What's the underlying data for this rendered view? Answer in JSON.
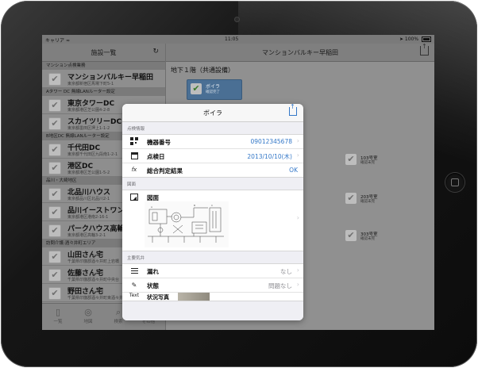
{
  "status_bar": {
    "carrier": "キャリア",
    "wifi": "≈",
    "time": "11:05",
    "location": "➤",
    "battery": "100%"
  },
  "master": {
    "title": "施設一覧",
    "refresh_icon": "refresh-icon",
    "sections": [
      {
        "header": "マンション点検業務",
        "rows": [
          {
            "name": "マンションバルキー早稲田",
            "address": "東京都新宿区馬場下町5-1"
          }
        ]
      },
      {
        "header": "Aタワー DC 無線LANルーター設定",
        "rows": [
          {
            "name": "東京タワーDC",
            "address": "東京都港区芝公園4-2-8"
          },
          {
            "name": "スカイツリーDC",
            "address": "東京都墨田区押上1-1-2"
          }
        ]
      },
      {
        "header": "B地区DC 無線LANルーター設定",
        "rows": [
          {
            "name": "千代田DC",
            "address": "東京都千代田区九段南1-2-1"
          },
          {
            "name": "港区DC",
            "address": "東京都港区芝公園1-5-2"
          }
        ]
      },
      {
        "header": "品川・大崎地区",
        "rows": [
          {
            "name": "北品川ハウス",
            "address": "東京都品川区北品川2-1"
          },
          {
            "name": "品川イーストワン",
            "address": "東京都港区港南2-16-1"
          },
          {
            "name": "パークハウス高輪",
            "address": "東京都港区高輪3-2-1"
          }
        ]
      },
      {
        "header": "訪問介護:酒々井町エリア",
        "rows": [
          {
            "name": "山田さん宅",
            "address": "千葉県印旛郡酒々井町上岩橋"
          },
          {
            "name": "佐藤さん宅",
            "address": "千葉県印旛郡酒々井町中央台"
          },
          {
            "name": "野田さん宅",
            "address": "千葉県印旛郡酒々井町東酒々井"
          }
        ]
      }
    ],
    "tabs": [
      {
        "label": "一覧",
        "icon": "list-icon"
      },
      {
        "label": "地図",
        "icon": "map-icon"
      },
      {
        "label": "検索",
        "icon": "search-icon"
      },
      {
        "label": "その他",
        "icon": "more-icon"
      }
    ]
  },
  "detail": {
    "title": "マンションバルキー早稲田",
    "share_icon": "share-icon",
    "floor": "地下１階（共通設備）",
    "boiler_chip": {
      "label": "ボイラ",
      "sub": "確認完了"
    },
    "rooms": [
      {
        "label": "103号室",
        "sub": "確認未完"
      },
      {
        "label": "203号室",
        "sub": "確認未完"
      },
      {
        "label": "303号室",
        "sub": "確認未完"
      }
    ]
  },
  "popover": {
    "title": "ボイラ",
    "share_icon": "share-icon",
    "inspection_section": "点検情報",
    "rows": {
      "equipment_no": {
        "label": "機器番号",
        "value": "09012345678",
        "icon": "qr-code-icon"
      },
      "inspection_date": {
        "label": "点検日",
        "value": "2013/10/10(木)",
        "icon": "calendar-icon"
      },
      "overall_result": {
        "label": "総合判定結果",
        "value": "OK",
        "icon": "fx-icon"
      }
    },
    "drawing_section": "図面",
    "drawing": {
      "label": "図面",
      "icon": "picture-icon"
    },
    "remarks_section": "主要気弁",
    "leak": {
      "label": "漏れ",
      "value": "なし",
      "icon": "list-icon"
    },
    "condition": {
      "label": "状態",
      "value": "問題なし",
      "icon": "pen-icon"
    },
    "text_tool": "Text",
    "photo_row": {
      "label": "状況写真"
    }
  },
  "colors": {
    "accent": "#3478c8",
    "dim": "#8f8f8f",
    "chip": "#4a6f94"
  }
}
